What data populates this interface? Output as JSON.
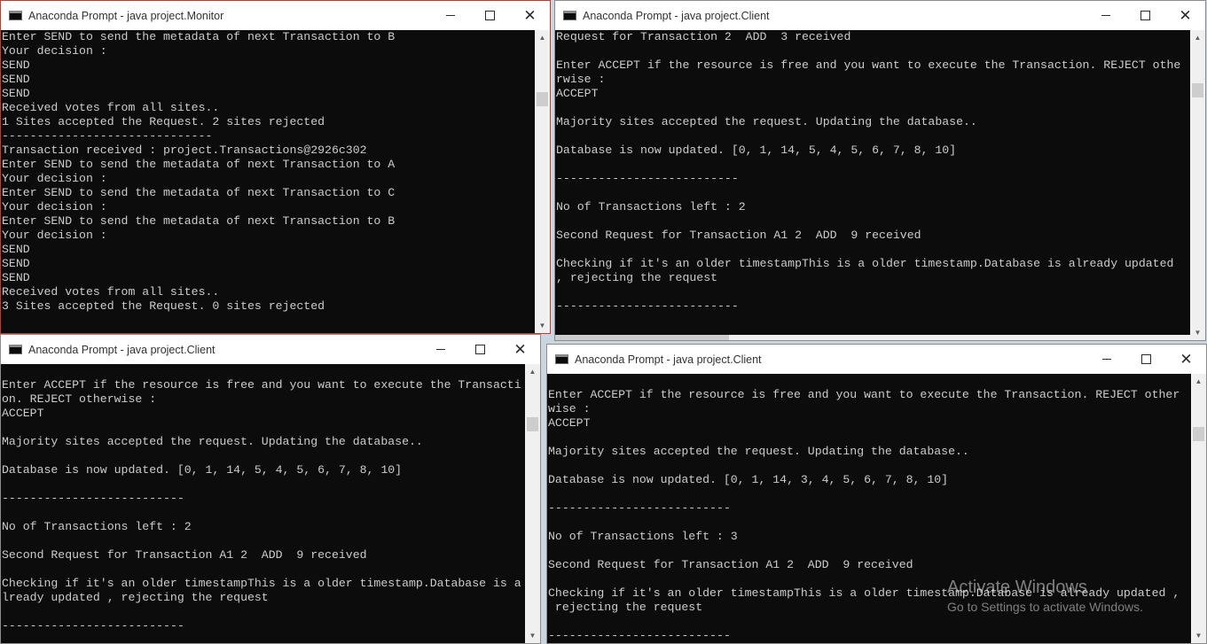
{
  "windows": [
    {
      "id": "monitor",
      "title": "Anaconda Prompt - java  project.Monitor",
      "lines": [
        "Enter SEND to send the metadata of next Transaction to B",
        "Your decision :",
        "SEND",
        "SEND",
        "SEND",
        "Received votes from all sites..",
        "1 Sites accepted the Request. 2 sites rejected",
        "------------------------------",
        "Transaction received : project.Transactions@2926c302",
        "Enter SEND to send the metadata of next Transaction to A",
        "Your decision :",
        "Enter SEND to send the metadata of next Transaction to C",
        "Your decision :",
        "Enter SEND to send the metadata of next Transaction to B",
        "Your decision :",
        "SEND",
        "SEND",
        "SEND",
        "Received votes from all sites..",
        "3 Sites accepted the Request. 0 sites rejected"
      ]
    },
    {
      "id": "client-a",
      "title": "Anaconda Prompt - java  project.Client",
      "lines": [
        "Request for Transaction 2  ADD  3 received",
        "",
        "Enter ACCEPT if the resource is free and you want to execute the Transaction. REJECT othe",
        "rwise :",
        "ACCEPT",
        "",
        "Majority sites accepted the request. Updating the database..",
        "",
        "Database is now updated. [0, 1, 14, 5, 4, 5, 6, 7, 8, 10]",
        "",
        "--------------------------",
        "",
        "No of Transactions left : 2",
        "",
        "Second Request for Transaction A1 2  ADD  9 received",
        "",
        "Checking if it's an older timestampThis is a older timestamp.Database is already updated",
        ", rejecting the request",
        "",
        "--------------------------"
      ]
    },
    {
      "id": "client-b",
      "title": "Anaconda Prompt - java  project.Client",
      "lines": [
        "",
        "Enter ACCEPT if the resource is free and you want to execute the Transacti",
        "on. REJECT otherwise :",
        "ACCEPT",
        "",
        "Majority sites accepted the request. Updating the database..",
        "",
        "Database is now updated. [0, 1, 14, 5, 4, 5, 6, 7, 8, 10]",
        "",
        "--------------------------",
        "",
        "No of Transactions left : 2",
        "",
        "Second Request for Transaction A1 2  ADD  9 received",
        "",
        "Checking if it's an older timestampThis is a older timestamp.Database is a",
        "lready updated , rejecting the request",
        "",
        "--------------------------"
      ]
    },
    {
      "id": "client-c",
      "title": "Anaconda Prompt - java  project.Client",
      "lines": [
        "",
        "Enter ACCEPT if the resource is free and you want to execute the Transaction. REJECT other",
        "wise :",
        "ACCEPT",
        "",
        "Majority sites accepted the request. Updating the database..",
        "",
        "Database is now updated. [0, 1, 14, 3, 4, 5, 6, 7, 8, 10]",
        "",
        "--------------------------",
        "",
        "No of Transactions left : 3",
        "",
        "Second Request for Transaction A1 2  ADD  9 received",
        "",
        "Checking if it's an older timestampThis is a older timestamp.Database is already updated ,",
        " rejecting the request",
        "",
        "--------------------------"
      ]
    }
  ],
  "watermark": {
    "line1": "Activate Windows",
    "line2": "Go to Settings to activate Windows."
  }
}
